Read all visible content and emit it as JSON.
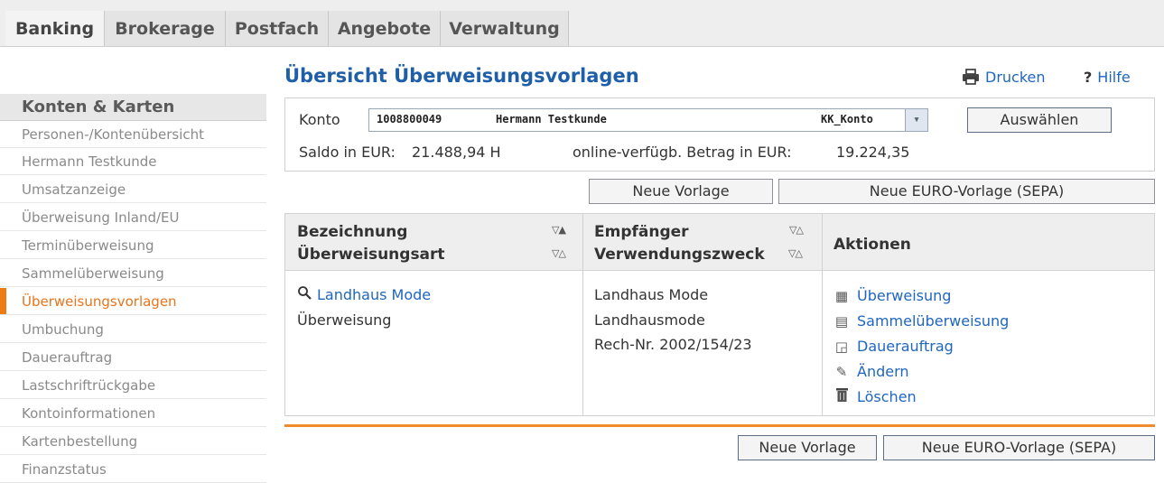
{
  "tabs": [
    {
      "label": "Banking",
      "active": true
    },
    {
      "label": "Brokerage",
      "active": false
    },
    {
      "label": "Postfach",
      "active": false
    },
    {
      "label": "Angebote",
      "active": false
    },
    {
      "label": "Verwaltung",
      "active": false
    }
  ],
  "sidebar": {
    "heading": "Konten & Karten",
    "items": [
      {
        "label": "Personen-/Kontenübersicht"
      },
      {
        "label": "Hermann Testkunde"
      },
      {
        "label": "Umsatzanzeige"
      },
      {
        "label": "Überweisung Inland/EU"
      },
      {
        "label": "Terminüberweisung"
      },
      {
        "label": "Sammelüberweisung"
      },
      {
        "label": "Überweisungsvorlagen",
        "active": true
      },
      {
        "label": "Umbuchung"
      },
      {
        "label": "Dauerauftrag"
      },
      {
        "label": "Lastschriftrückgabe"
      },
      {
        "label": "Kontoinformationen"
      },
      {
        "label": "Kartenbestellung"
      },
      {
        "label": "Finanzstatus"
      }
    ]
  },
  "header": {
    "title": "Übersicht Überweisungsvorlagen",
    "print_label": "Drucken",
    "help_label": "Hilfe"
  },
  "account": {
    "konto_label": "Konto",
    "selected_number": "1008800049",
    "selected_name": "Hermann Testkunde",
    "selected_type": "KK_Konto",
    "select_button": "Auswählen",
    "saldo_label": "Saldo in EUR:",
    "saldo_value": "21.488,94 H",
    "available_label": "online-verfügb. Betrag in EUR:",
    "available_value": "19.224,35"
  },
  "buttons": {
    "new_template": "Neue Vorlage",
    "new_euro_template": "Neue EURO-Vorlage (SEPA)"
  },
  "table": {
    "col1_line1": "Bezeichnung",
    "col1_line2": "Überweisungsart",
    "col2_line1": "Empfänger",
    "col2_line2": "Verwendungszweck",
    "col3": "Aktionen",
    "row": {
      "name": "Landhaus Mode",
      "type": "Überweisung",
      "recipient": "Landhaus Mode",
      "purpose_1": "Landhausmode",
      "purpose_2": "Rech-Nr. 2002/154/23"
    },
    "actions": [
      {
        "label": "Überweisung",
        "icon": "transfer-form-icon"
      },
      {
        "label": "Sammelüberweisung",
        "icon": "batch-transfer-icon"
      },
      {
        "label": "Dauerauftrag",
        "icon": "standing-order-icon"
      },
      {
        "label": "Ändern",
        "icon": "pencil-icon"
      },
      {
        "label": "Löschen",
        "icon": "trash-icon"
      }
    ]
  },
  "colors": {
    "link": "#1f66bf",
    "title": "#1f5fa9",
    "accent": "#ef7b16"
  }
}
